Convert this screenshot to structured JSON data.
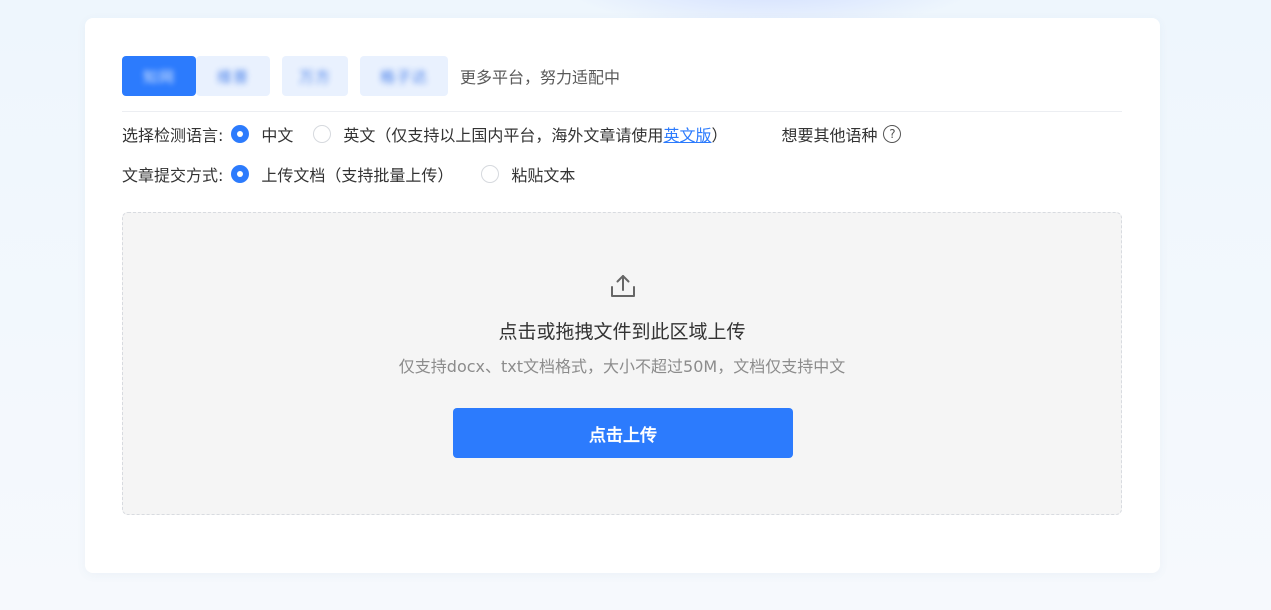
{
  "platform_tabs": [
    {
      "label": "知网",
      "active": true
    },
    {
      "label": "维普",
      "active": false
    },
    {
      "label": "万方",
      "active": false
    },
    {
      "label": "格子达",
      "active": false
    }
  ],
  "more_platforms": "更多平台，努力适配中",
  "language": {
    "label": "选择检测语言:",
    "options": [
      {
        "label": "中文",
        "checked": true
      },
      {
        "label_prefix": "英文（仅支持以上国内平台，海外文章请使用",
        "link": "英文版",
        "label_suffix": "）",
        "checked": false
      }
    ],
    "other_languages": "想要其他语种",
    "help_icon": "?"
  },
  "submit_mode": {
    "label": "文章提交方式:",
    "options": [
      {
        "label": "上传文档（支持批量上传）",
        "checked": true
      },
      {
        "label": "粘贴文本",
        "checked": false
      }
    ]
  },
  "dropzone": {
    "icon": "upload-icon",
    "title": "点击或拖拽文件到此区域上传",
    "subtitle": "仅支持docx、txt文档格式，大小不超过50M，文档仅支持中文",
    "button_label": "点击上传"
  },
  "colors": {
    "accent": "#2c7bfd",
    "tab_bg": "#e9f1fe",
    "dropzone_bg": "#f5f5f5"
  }
}
